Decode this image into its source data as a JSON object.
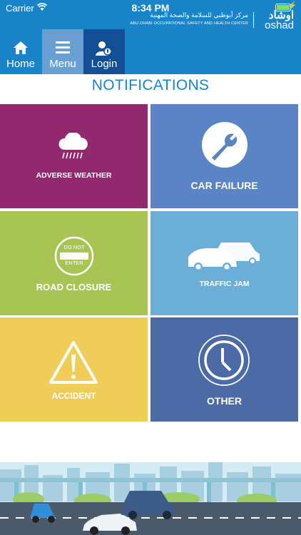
{
  "status_bar": {
    "carrier": "Carrier",
    "time": "8:34 PM"
  },
  "brand": {
    "arabic_name": "مركز أبوظبي للسلامة والصحة المهنية",
    "english_name": "ABU DHABI OCCUPATIONAL SAFETY AND HEALTH CENTER",
    "logo_arabic": "اوشاد",
    "logo_english": "oshad"
  },
  "nav": {
    "home": "Home",
    "menu": "Menu",
    "login": "Login"
  },
  "page_title": "NOTIFICATIONS",
  "tiles": [
    {
      "label": "ADVERSE WEATHER",
      "icon": "rain-cloud-icon",
      "color": "#92286e"
    },
    {
      "label": "CAR FAILURE",
      "icon": "wrench-icon",
      "color": "#5b84c6"
    },
    {
      "label": "ROAD CLOSURE",
      "icon": "do-not-enter-icon",
      "sign_top": "DO NOT",
      "sign_bottom": "ENTER",
      "color": "#a8c453"
    },
    {
      "label": "TRAFFIC JAM",
      "icon": "cars-icon",
      "color": "#6bafd9"
    },
    {
      "label": "ACCIDENT",
      "icon": "warning-triangle-icon",
      "color": "#efcd58"
    },
    {
      "label": "OTHER",
      "icon": "clock-icon",
      "color": "#4c6aa5"
    }
  ],
  "colors": {
    "header": "#1a84c9",
    "menu_active": "#6a9fd3",
    "login_bg": "#124f94"
  }
}
